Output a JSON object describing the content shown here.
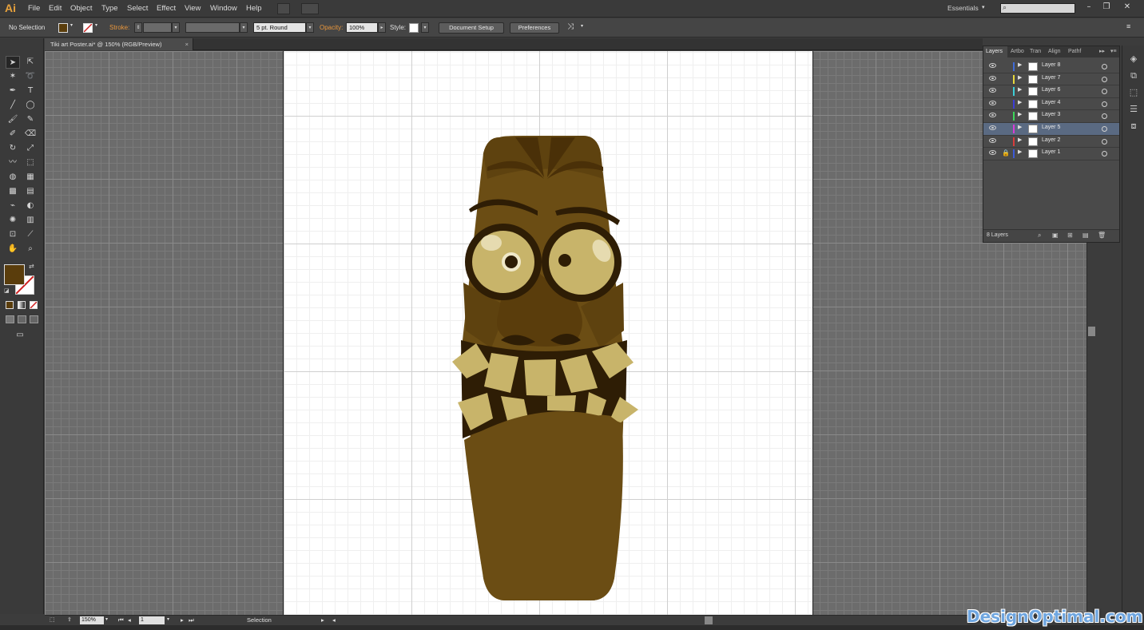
{
  "app": {
    "logo": "Ai",
    "workspace": "Essentials"
  },
  "menu": [
    "File",
    "Edit",
    "Object",
    "Type",
    "Select",
    "Effect",
    "View",
    "Window",
    "Help"
  ],
  "window_controls": [
    "minimize",
    "restore",
    "close"
  ],
  "control_bar": {
    "selection": "No Selection",
    "stroke_label": "Stroke:",
    "brush": "5 pt. Round",
    "opacity_label": "Opacity:",
    "opacity_value": "100%",
    "style_label": "Style:",
    "document_setup": "Document Setup",
    "preferences": "Preferences",
    "fill_color": "#5a3d0c"
  },
  "document": {
    "tab_title": "Tiki art Poster.ai* @ 150% (RGB/Preview)",
    "close": "×"
  },
  "tools": [
    "selection-tool",
    "direct-selection-tool",
    "magic-wand-tool",
    "lasso-tool",
    "pen-tool",
    "type-tool",
    "line-tool",
    "ellipse-tool",
    "paintbrush-tool",
    "pencil-tool",
    "blob-brush-tool",
    "eraser-tool",
    "rotate-tool",
    "scale-tool",
    "warp-tool",
    "free-transform-tool",
    "shape-builder-tool",
    "perspective-grid-tool",
    "mesh-tool",
    "gradient-tool",
    "eyedropper-tool",
    "blend-tool",
    "symbol-sprayer-tool",
    "column-graph-tool",
    "artboard-tool",
    "slice-tool",
    "hand-tool",
    "zoom-tool"
  ],
  "status_bar": {
    "zoom": "150%",
    "artboard": "1",
    "tool": "Selection"
  },
  "layers_panel": {
    "tabs": [
      "Layers",
      "Artbo",
      "Tran",
      "Align",
      "Pathf"
    ],
    "layers": [
      {
        "name": "Layer 8",
        "color": "#3f6bd8",
        "locked": false,
        "selected": false
      },
      {
        "name": "Layer 7",
        "color": "#e8d83c",
        "locked": false,
        "selected": false
      },
      {
        "name": "Layer 6",
        "color": "#3ccfd8",
        "locked": false,
        "selected": false
      },
      {
        "name": "Layer 4",
        "color": "#3c3cd8",
        "locked": false,
        "selected": false
      },
      {
        "name": "Layer 3",
        "color": "#3cd85a",
        "locked": false,
        "selected": false
      },
      {
        "name": "Layer 5",
        "color": "#d83cd8",
        "locked": false,
        "selected": true
      },
      {
        "name": "Layer 2",
        "color": "#d83c3c",
        "locked": false,
        "selected": false
      },
      {
        "name": "Layer 1",
        "color": "#3c5ad8",
        "locked": true,
        "selected": false
      }
    ],
    "count": "8 Layers"
  },
  "artwork": {
    "wood": "#6b4d14",
    "dark": "#3a2408",
    "teeth": "#c8b46a",
    "eye": "#c8b46a"
  },
  "watermark": "DesignOptimal.com"
}
